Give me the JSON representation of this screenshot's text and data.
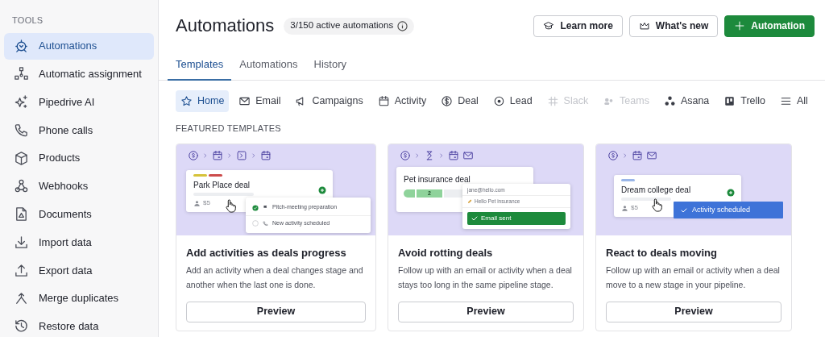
{
  "sidebar": {
    "heading": "TOOLS",
    "items": [
      {
        "label": "Automations",
        "selected": true
      },
      {
        "label": "Automatic assignment",
        "selected": false
      },
      {
        "label": "Pipedrive AI",
        "selected": false
      },
      {
        "label": "Phone calls",
        "selected": false
      },
      {
        "label": "Products",
        "selected": false
      },
      {
        "label": "Webhooks",
        "selected": false
      },
      {
        "label": "Documents",
        "selected": false
      },
      {
        "label": "Import data",
        "selected": false
      },
      {
        "label": "Export data",
        "selected": false
      },
      {
        "label": "Merge duplicates",
        "selected": false
      },
      {
        "label": "Restore data",
        "selected": false
      }
    ]
  },
  "header": {
    "title": "Automations",
    "badge": "3/150 active automations",
    "buttons": [
      {
        "label": "Learn more",
        "kind": "outline"
      },
      {
        "label": "What's new",
        "kind": "outline"
      },
      {
        "label": "Automation",
        "kind": "primary"
      }
    ]
  },
  "tabs": [
    {
      "label": "Templates",
      "selected": true
    },
    {
      "label": "Automations",
      "selected": false
    },
    {
      "label": "History",
      "selected": false
    }
  ],
  "filters": [
    {
      "label": "Home",
      "selected": true,
      "dimmed": false
    },
    {
      "label": "Email",
      "selected": false,
      "dimmed": false
    },
    {
      "label": "Campaigns",
      "selected": false,
      "dimmed": false
    },
    {
      "label": "Activity",
      "selected": false,
      "dimmed": false
    },
    {
      "label": "Deal",
      "selected": false,
      "dimmed": false
    },
    {
      "label": "Lead",
      "selected": false,
      "dimmed": false
    },
    {
      "label": "Slack",
      "selected": false,
      "dimmed": true
    },
    {
      "label": "Teams",
      "selected": false,
      "dimmed": true
    },
    {
      "label": "Asana",
      "selected": false,
      "dimmed": false
    },
    {
      "label": "Trello",
      "selected": false,
      "dimmed": false
    },
    {
      "label": "All",
      "selected": false,
      "dimmed": false
    }
  ],
  "section_title": "FEATURED TEMPLATES",
  "cards": [
    {
      "illustration": {
        "kind": "activities",
        "deal": "Park Place deal",
        "value": "$5",
        "popup_rows": [
          {
            "label": "Pitch-meeting preparation",
            "checked": true
          },
          {
            "label": "New activity scheduled",
            "checked": false
          }
        ]
      },
      "title": "Add activities as deals progress",
      "description": "Add an activity when a deal changes stage and another when the last one is done.",
      "button": "Preview"
    },
    {
      "illustration": {
        "kind": "email",
        "deal": "Pet insurance deal",
        "stage": "2",
        "from": "jane@hello.com",
        "subject": "Hello Pet insurance",
        "status": "Email sent"
      },
      "title": "Avoid rotting deals",
      "description": "Follow up with an email or activity when a deal stays too long in the same pipeline stage.",
      "button": "Preview"
    },
    {
      "illustration": {
        "kind": "scheduled",
        "deal": "Dream college deal",
        "value": "$5",
        "status": "Activity scheduled"
      },
      "title": "React to deals moving",
      "description": "Follow up with an email or activity when a deal move to a new stage in your pipeline.",
      "button": "Preview"
    }
  ]
}
